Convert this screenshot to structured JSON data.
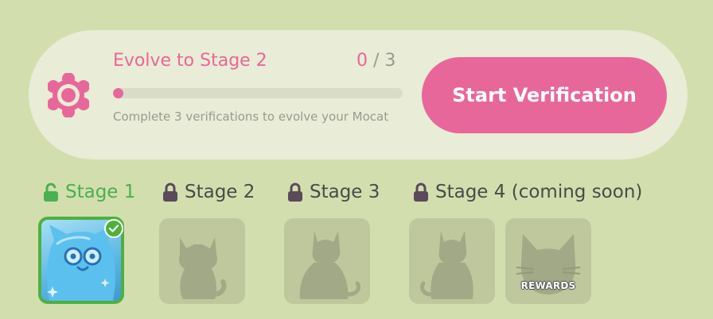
{
  "evolve": {
    "title": "Evolve to Stage 2",
    "current": "0",
    "separator": " / ",
    "total": "3",
    "progress": 0,
    "hint": "Complete 3 verifications to evolve your Mocat",
    "button_label": "Start Verification"
  },
  "stages": [
    {
      "label": "Stage 1",
      "locked": false,
      "icon": "unlock-icon"
    },
    {
      "label": "Stage 2",
      "locked": true,
      "icon": "lock-icon"
    },
    {
      "label": "Stage 3",
      "locked": true,
      "icon": "lock-icon"
    },
    {
      "label": "Stage 4 (coming soon)",
      "locked": true,
      "icon": "lock-icon"
    }
  ],
  "rewards": {
    "label": "REWARDS"
  },
  "colors": {
    "background": "#d3deae",
    "card": "#e9ecd6",
    "accent_pink": "#e8679a",
    "unlocked_green": "#4caf50",
    "tile_locked": "#bfc79c",
    "silhouette": "#a1a987"
  }
}
